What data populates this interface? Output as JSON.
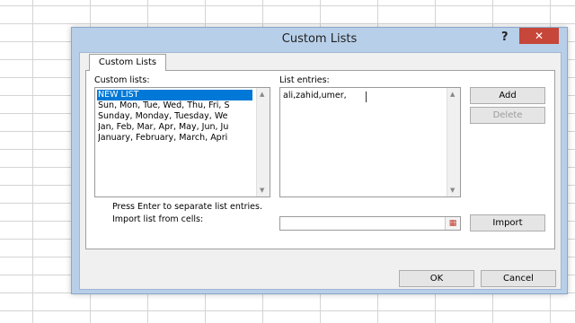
{
  "dialog": {
    "title": "Custom Lists",
    "help_label": "?",
    "close_label": "✕",
    "tab_label": "Custom Lists",
    "custom_lists_label": "Custom lists:",
    "custom_lists": [
      "NEW LIST",
      "Sun, Mon, Tue, Wed, Thu, Fri, S",
      "Sunday, Monday, Tuesday, We",
      "Jan, Feb, Mar, Apr, May, Jun, Ju",
      "January, February, March, Apri"
    ],
    "list_entries_label": "List entries:",
    "list_entries_value": "ali,zahid,umer,",
    "add_label": "Add",
    "delete_label": "Delete",
    "hint": "Press Enter to separate list entries.",
    "import_label": "Import list from cells:",
    "import_value": "",
    "import_button_label": "Import",
    "ok_label": "OK",
    "cancel_label": "Cancel"
  },
  "icons": {
    "help": "help-icon",
    "close": "close-icon",
    "range_picker": "range-picker-icon",
    "scroll_up": "chevron-up-icon",
    "scroll_down": "chevron-down-icon"
  },
  "colors": {
    "title_bar": "#b8cfe9",
    "close_button": "#c6463a",
    "selection": "#0078d7"
  }
}
